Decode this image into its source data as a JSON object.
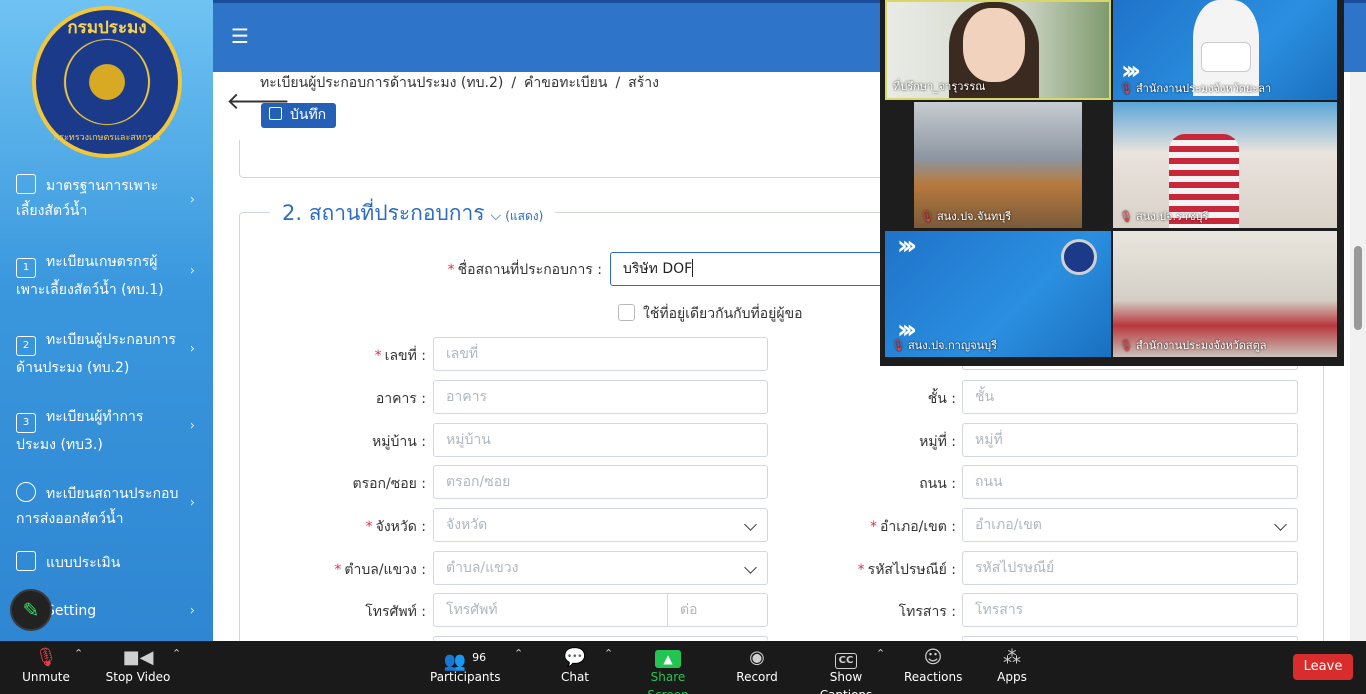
{
  "sidebar": {
    "logo_top_text": "กรมประมง",
    "logo_bottom_text": "กระทรวงเกษตรและสหกรณ์",
    "items": [
      {
        "label": "มาตรฐานการเพาะเลี้ยงสัตว์น้ำ",
        "icon": "document-icon"
      },
      {
        "label": "ทะเบียนเกษตรกรผู้เพาะเลี้ยงสัตว์น้ำ (ทบ.1)",
        "icon": "number-1-icon",
        "num": "1"
      },
      {
        "label": "ทะเบียนผู้ประกอบการด้านประมง (ทบ.2)",
        "icon": "number-2-icon",
        "num": "2"
      },
      {
        "label": "ทะเบียนผู้ทำการประมง (ทบ3.)",
        "icon": "number-3-icon",
        "num": "3"
      },
      {
        "label": "ทะเบียนสถานประกอบการส่งออกสัตว์น้ำ",
        "icon": "globe-icon"
      },
      {
        "label": "แบบประเมิน",
        "icon": "form-icon"
      },
      {
        "label": "Setting",
        "icon": "gear-icon"
      }
    ]
  },
  "breadcrumb": [
    "ทะเบียนผู้ประกอบการด้านประมง (ทบ.2)",
    "คำขอทะเบียน",
    "สร้าง"
  ],
  "toolbar": {
    "save_label": "บันทึก"
  },
  "section": {
    "title": "2. สถานที่ประกอบการ",
    "toggle": "(แสดง)"
  },
  "form": {
    "business_name_label": "ชื่อสถานที่ประกอบการ :",
    "business_name_value": "บริษัท DOF",
    "same_address_label": "ใช้ที่อยู่เดียวกันกับที่อยู่ผู้ขอ",
    "house_no_label": "เลขที่ :",
    "house_no_ph": "เลขที่",
    "building_label": "อาคาร :",
    "building_ph": "อาคาร",
    "floor_label": "ชั้น :",
    "floor_ph": "ชั้น",
    "village_label": "หมู่บ้าน :",
    "village_ph": "หมู่บ้าน",
    "moo_label": "หมู่ที่ :",
    "moo_ph": "หมู่ที่",
    "soi_label": "ตรอก/ซอย :",
    "soi_ph": "ตรอก/ซอย",
    "road_label": "ถนน :",
    "road_ph": "ถนน",
    "province_label": "จังหวัด :",
    "province_ph": "จังหวัด",
    "district_label": "อำเภอ/เขต :",
    "district_ph": "อำเภอ/เขต",
    "subdistrict_label": "ตำบล/แขวง :",
    "subdistrict_ph": "ตำบล/แขวง",
    "postcode_label": "รหัสไปรษณีย์ :",
    "postcode_ph": "รหัสไปรษณีย์",
    "phone_label": "โทรศัพท์ :",
    "phone_ph": "โทรศัพท์",
    "ext_ph": "ต่อ",
    "fax_label": "โทรสาร :",
    "fax_ph": "โทรสาร"
  },
  "video": {
    "tiles": [
      {
        "name": "ที่ปรึกษา_จารุวรรณ"
      },
      {
        "name": "สำนักงานประมงจังหวัดยะลา"
      },
      {
        "name": "สนง.ปจ.จันทบุรี"
      },
      {
        "name": "สนง.ปจ.ราชบุรี"
      },
      {
        "name": "สนง.ปจ.กาญจนบุรี"
      },
      {
        "name": "สำนักงานประมงจังหวัดสตูล"
      }
    ]
  },
  "zoom": {
    "unmute": "Unmute",
    "stop_video": "Stop Video",
    "participants": "Participants",
    "participants_count": "96",
    "chat": "Chat",
    "share_screen": "Share Screen",
    "record": "Record",
    "show_captions": "Show Captions",
    "captions_badge": "CC",
    "reactions": "Reactions",
    "apps": "Apps",
    "leave": "Leave"
  },
  "colors": {
    "header": "#2e74c9",
    "accent": "#2b6dc4",
    "share_green": "#23c552",
    "leave_red": "#d92d2d"
  }
}
